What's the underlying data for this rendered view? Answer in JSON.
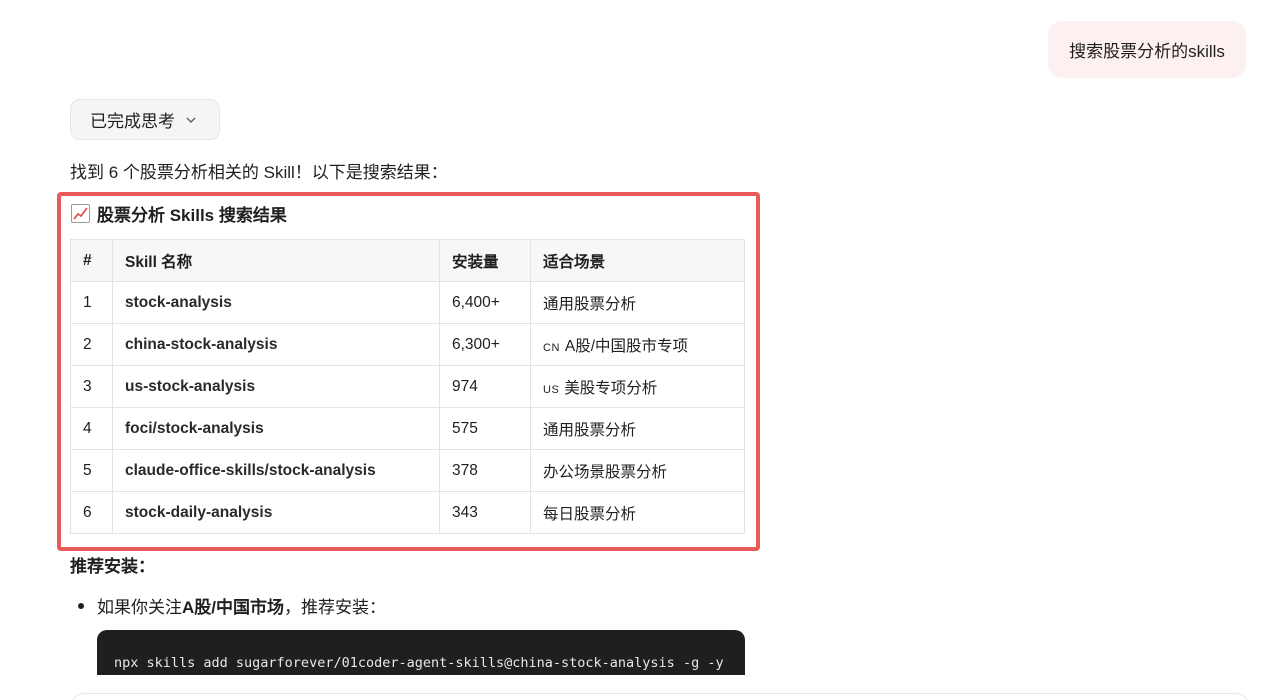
{
  "user_message": "搜索股票分析的skills",
  "thinking_chip": {
    "label": "已完成思考",
    "icon": "chevron-down-icon"
  },
  "intro_text": "找到 6 个股票分析相关的 Skill！以下是搜索结果：",
  "section_title": {
    "emoji": "chart-increasing-icon",
    "text": "股票分析 Skills 搜索结果"
  },
  "table": {
    "headers": [
      "#",
      "Skill 名称",
      "安装量",
      "适合场景"
    ],
    "rows": [
      {
        "idx": "1",
        "name": "stock-analysis",
        "installs": "6,400+",
        "flag": "",
        "scene": "通用股票分析"
      },
      {
        "idx": "2",
        "name": "china-stock-analysis",
        "installs": "6,300+",
        "flag": "CN",
        "scene": "A股/中国股市专项"
      },
      {
        "idx": "3",
        "name": "us-stock-analysis",
        "installs": "974",
        "flag": "US",
        "scene": "美股专项分析"
      },
      {
        "idx": "4",
        "name": "foci/stock-analysis",
        "installs": "575",
        "flag": "",
        "scene": "通用股票分析"
      },
      {
        "idx": "5",
        "name": "claude-office-skills/stock-analysis",
        "installs": "378",
        "flag": "",
        "scene": "办公场景股票分析"
      },
      {
        "idx": "6",
        "name": "stock-daily-analysis",
        "installs": "343",
        "flag": "",
        "scene": "每日股票分析"
      }
    ]
  },
  "recommend": {
    "heading": "推荐安装：",
    "bullet_prefix": "如果你关注 ",
    "bullet_bold": "A股/中国市场",
    "bullet_suffix": "，推荐安装：",
    "code": "npx skills add sugarforever/01coder-agent-skills@china-stock-analysis -g -y"
  },
  "colors": {
    "highlight": "#e85a5a",
    "user_bubble": "#fdf0f0",
    "code_bg": "#1f1f1f"
  }
}
